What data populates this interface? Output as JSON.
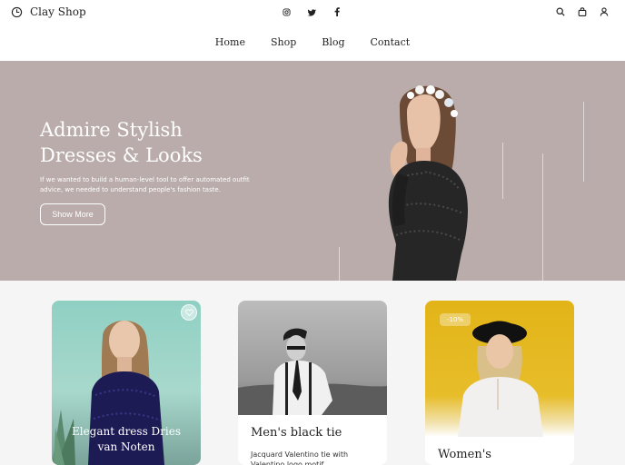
{
  "header": {
    "brand_name": "Clay Shop",
    "socials": [
      "instagram-icon",
      "twitter-icon",
      "facebook-icon"
    ],
    "actions": [
      "search-icon",
      "bag-icon",
      "user-icon"
    ]
  },
  "nav": {
    "items": [
      {
        "label": "Home"
      },
      {
        "label": "Shop"
      },
      {
        "label": "Blog"
      },
      {
        "label": "Contact"
      }
    ]
  },
  "hero": {
    "title": "Admire Stylish Dresses & Looks",
    "description": "If we wanted to build a human-level tool to offer automated outfit advice, we needed to understand people's fashion taste.",
    "button_label": "Show More",
    "background_color": "#b9acaa"
  },
  "cards": [
    {
      "title": "Elegant dress Dries van Noten"
    },
    {
      "title": "Men's black tie",
      "description": "Jacquard Valentino tie with Valentino logo motif"
    },
    {
      "title": "Women's",
      "badge": "-10%"
    }
  ]
}
